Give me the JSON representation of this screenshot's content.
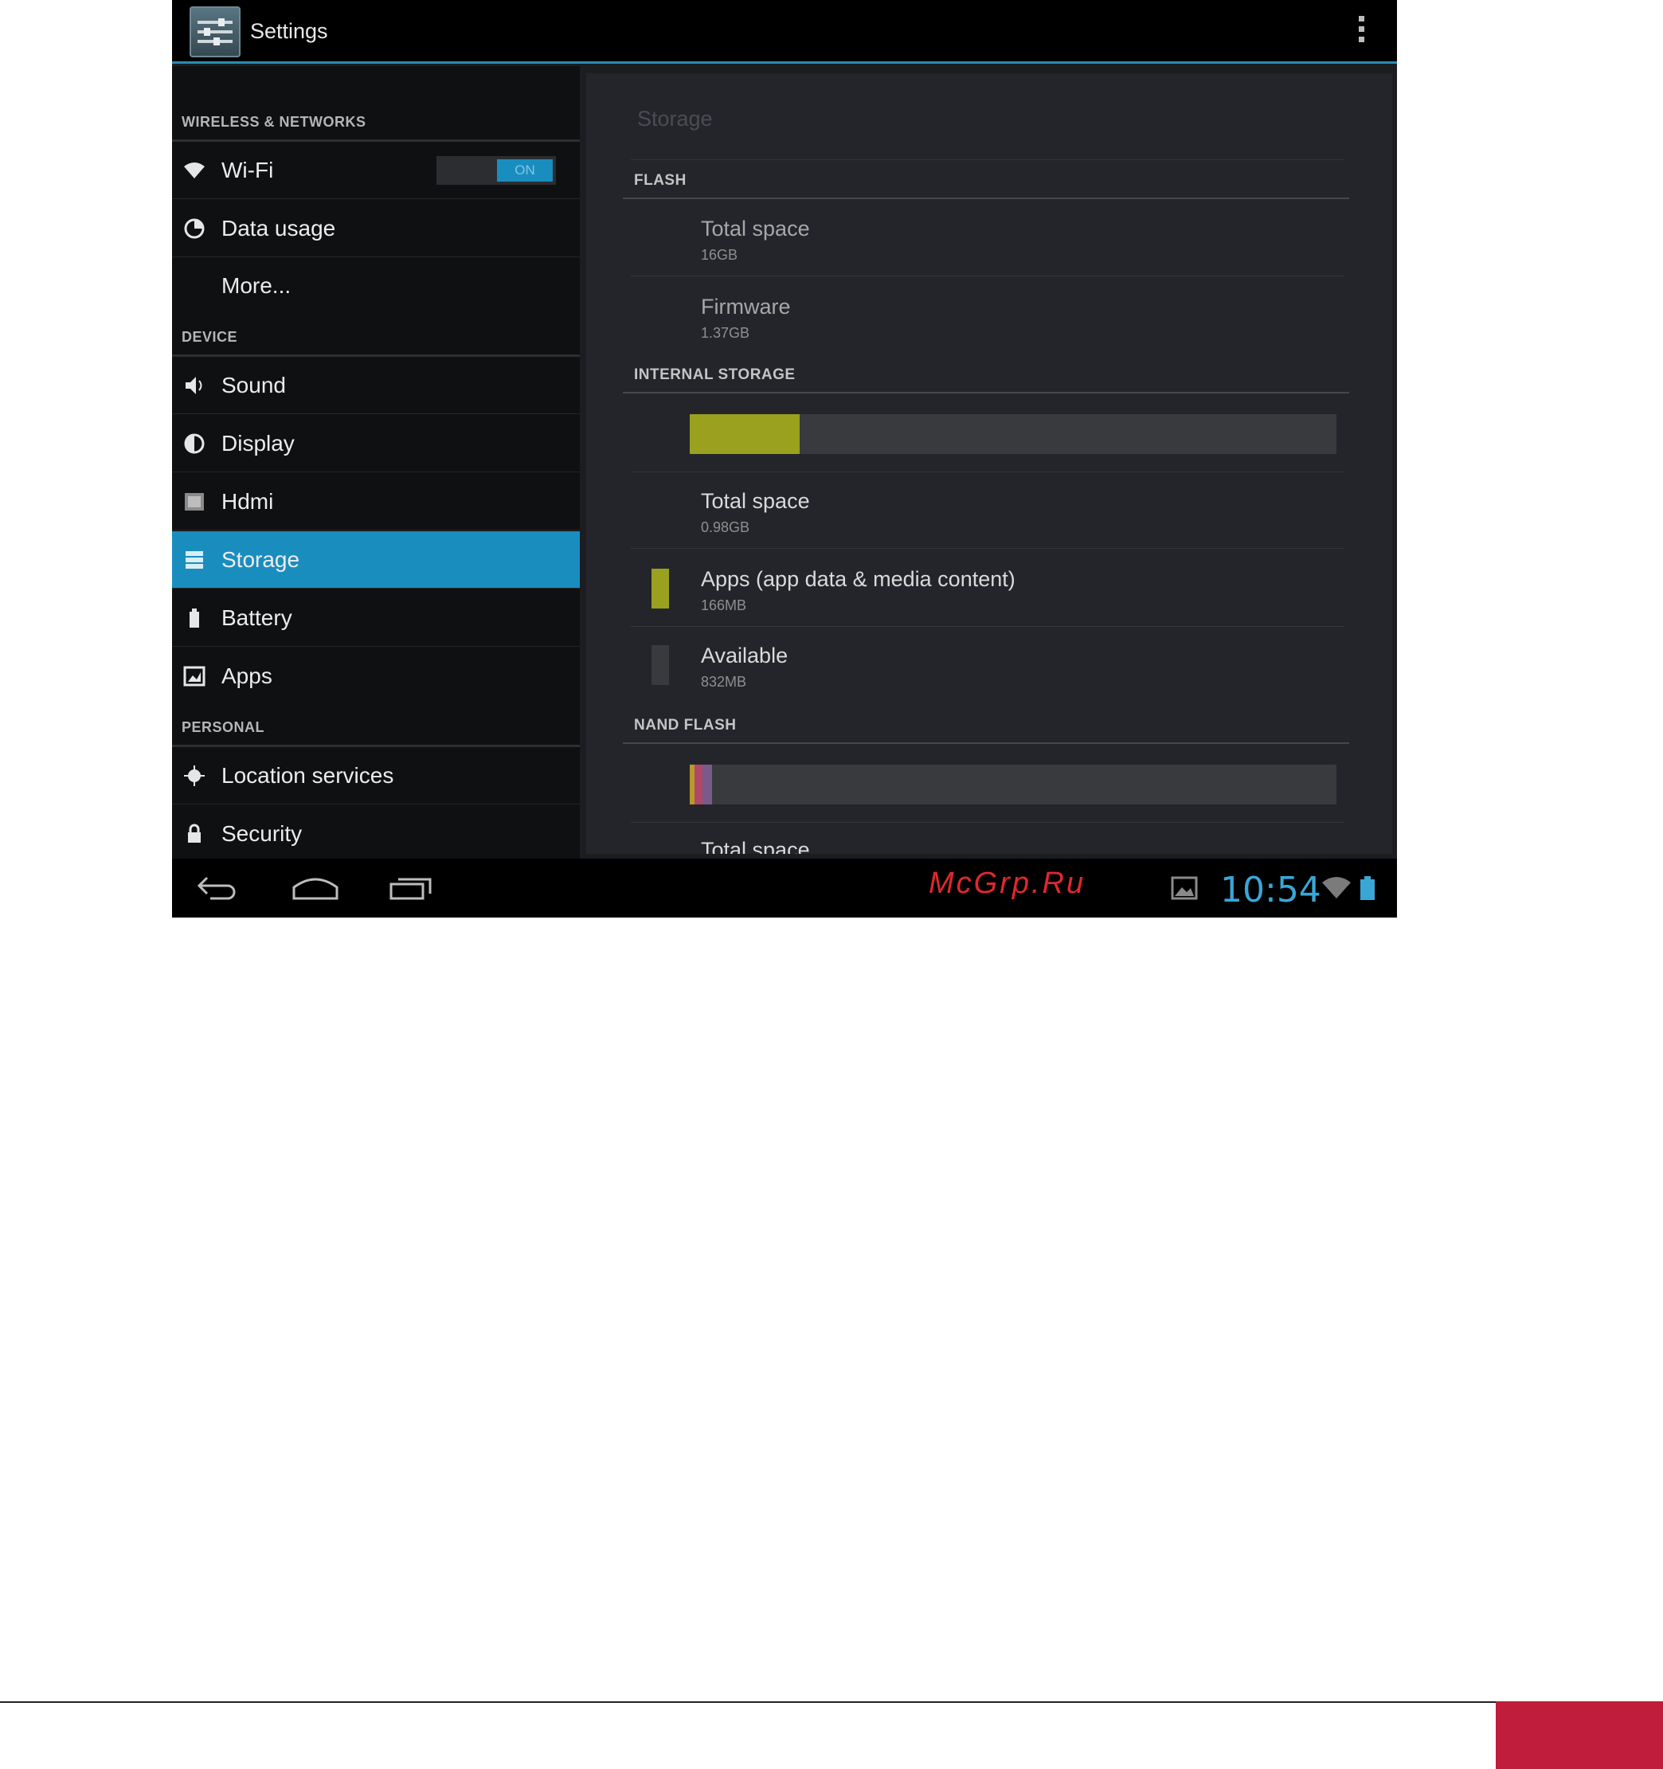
{
  "window": {
    "title": "Settings"
  },
  "nav": {
    "sections": [
      {
        "label": "WIRELESS & NETWORKS"
      },
      {
        "label": "DEVICE"
      },
      {
        "label": "PERSONAL"
      }
    ],
    "items": [
      {
        "label": "Wi-Fi",
        "icon": "wifi-icon",
        "toggle": "ON"
      },
      {
        "label": "Data usage",
        "icon": "data-usage-icon"
      },
      {
        "label": "More..."
      },
      {
        "label": "Sound",
        "icon": "speaker-icon"
      },
      {
        "label": "Display",
        "icon": "display-icon"
      },
      {
        "label": "Hdmi",
        "icon": "hdmi-icon"
      },
      {
        "label": "Storage",
        "icon": "storage-icon",
        "selected": true
      },
      {
        "label": "Battery",
        "icon": "battery-icon"
      },
      {
        "label": "Apps",
        "icon": "apps-icon"
      },
      {
        "label": "Location services",
        "icon": "location-icon"
      },
      {
        "label": "Security",
        "icon": "lock-icon"
      }
    ]
  },
  "content": {
    "title": "Storage",
    "flash": {
      "header": "FLASH",
      "total": {
        "label": "Total space",
        "value": "16GB"
      },
      "firmware": {
        "label": "Firmware",
        "value": "1.37GB"
      }
    },
    "internal": {
      "header": "INTERNAL STORAGE",
      "usage_fraction": 0.17,
      "total": {
        "label": "Total space",
        "value": "0.98GB"
      },
      "apps": {
        "label": "Apps (app data & media content)",
        "value": "166MB"
      },
      "available": {
        "label": "Available",
        "value": "832MB"
      }
    },
    "nand": {
      "header": "NAND FLASH",
      "partial_label": "Total space"
    }
  },
  "status": {
    "time": "10:54"
  },
  "colors": {
    "accent": "#1a8dbf",
    "apps_bar": "#9aa11f",
    "clock": "#3aa6d8",
    "watermark": "#e0282e",
    "footer_block": "#c01c3c"
  },
  "watermark": "McGrp.Ru"
}
